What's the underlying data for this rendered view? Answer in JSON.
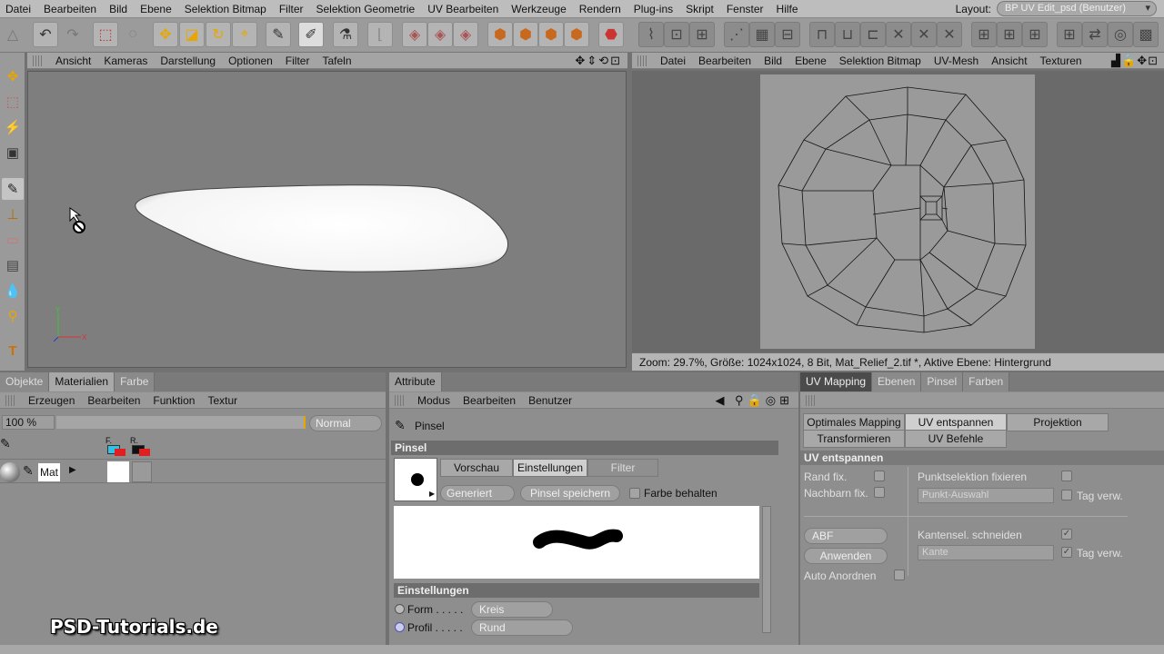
{
  "menubar": {
    "items": [
      "Datei",
      "Bearbeiten",
      "Bild",
      "Ebene",
      "Selektion Bitmap",
      "Filter",
      "Selektion Geometrie",
      "UV Bearbeiten",
      "Werkzeuge",
      "Rendern",
      "Plug-ins",
      "Skript",
      "Fenster",
      "Hilfe"
    ],
    "layout_label": "Layout:",
    "layout_value": "BP UV Edit_psd (Benutzer)"
  },
  "viewport": {
    "menu": [
      "Ansicht",
      "Kameras",
      "Darstellung",
      "Optionen",
      "Filter",
      "Tafeln"
    ],
    "axis_y": "Y",
    "axis_x": "X"
  },
  "uv_view": {
    "menu": [
      "Datei",
      "Bearbeiten",
      "Bild",
      "Ebene",
      "Selektion Bitmap",
      "UV-Mesh",
      "Ansicht",
      "Texturen"
    ],
    "status": "Zoom: 29.7%, Größe: 1024x1024, 8 Bit, Mat_Relief_2.tif *, Aktive Ebene: Hintergrund"
  },
  "materials": {
    "tabs": [
      "Objekte",
      "Materialien",
      "Farbe"
    ],
    "menu": [
      "Erzeugen",
      "Bearbeiten",
      "Funktion",
      "Textur"
    ],
    "zoom": "100 %",
    "blend": "Normal",
    "layer_f": "F.",
    "layer_r": "R.",
    "mat_name": "Mat"
  },
  "attribute": {
    "tab": "Attribute",
    "menu": [
      "Modus",
      "Bearbeiten",
      "Benutzer"
    ],
    "tool_name": "Pinsel",
    "section": "Pinsel",
    "subtabs": [
      "Vorschau",
      "Einstellungen",
      "Filter"
    ],
    "preset": "Generiert",
    "save_btn": "Pinsel speichern",
    "keep_color": "Farbe behalten",
    "settings_title": "Einstellungen",
    "form_label": "Form . . . . .",
    "form_value": "Kreis",
    "profil_label": "Profil . . . . .",
    "profil_value": "Rund"
  },
  "uvmapping": {
    "tabs": [
      "UV Mapping",
      "Ebenen",
      "Pinsel",
      "Farben"
    ],
    "btns_row1": [
      "Optimales Mapping",
      "UV entspannen",
      "Projektion"
    ],
    "btns_row2": [
      "Transformieren",
      "UV Befehle"
    ],
    "section": "UV entspannen",
    "rand_fix": "Rand fix.",
    "nachbarn_fix": "Nachbarn fix.",
    "punktsel": "Punktselektion fixieren",
    "punkt_auswahl": "Punkt-Auswahl",
    "tag_verw": "Tag verw.",
    "abf": "ABF",
    "anwenden": "Anwenden",
    "auto_anordnen": "Auto Anordnen",
    "kantensel": "Kantensel. schneiden",
    "kante": "Kante"
  },
  "watermark": "PSD-Tutorials.de",
  "colors": {
    "menubar": "#bdbdbd",
    "toolbar": "#9b9b9b",
    "panel": "#8e8e8e"
  }
}
